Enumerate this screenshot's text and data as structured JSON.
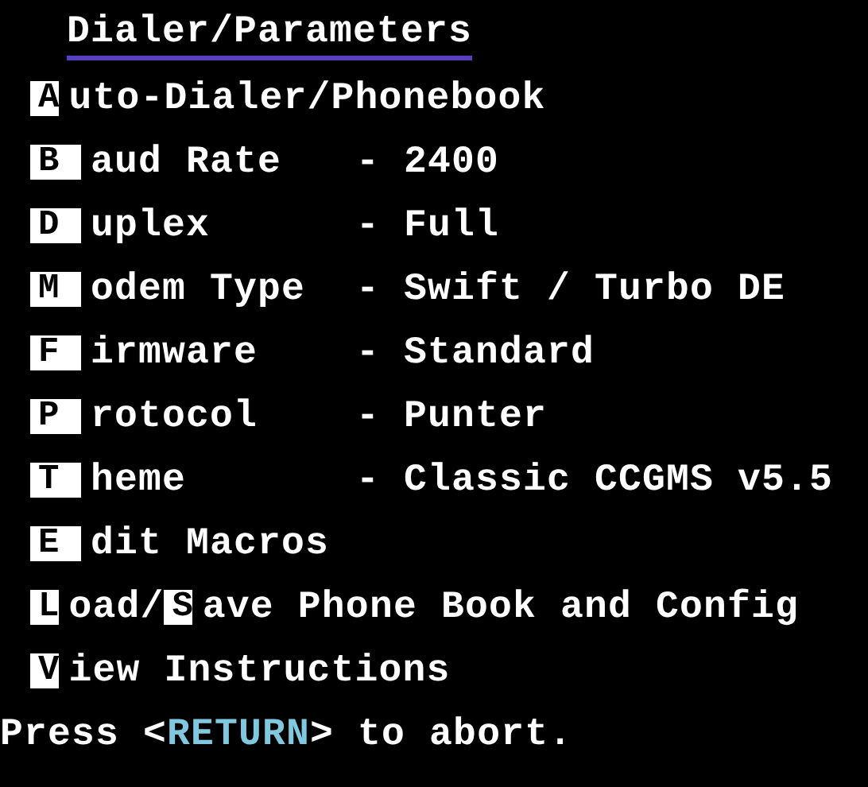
{
  "title": "Dialer/Parameters",
  "items": [
    {
      "parts": [
        {
          "kind": "key",
          "text": "A"
        },
        {
          "kind": "text",
          "text": "uto-Dialer/Phonebook"
        }
      ]
    },
    {
      "parts": [
        {
          "kind": "key",
          "text": "B"
        },
        {
          "kind": "text",
          "text": "aud Rate"
        }
      ],
      "value": "- 2400"
    },
    {
      "parts": [
        {
          "kind": "key",
          "text": "D"
        },
        {
          "kind": "text",
          "text": "uplex"
        }
      ],
      "value": "- Full"
    },
    {
      "parts": [
        {
          "kind": "key",
          "text": "M"
        },
        {
          "kind": "text",
          "text": "odem Type"
        }
      ],
      "value": "- Swift / Turbo DE"
    },
    {
      "parts": [
        {
          "kind": "key",
          "text": "F"
        },
        {
          "kind": "text",
          "text": "irmware"
        }
      ],
      "value": "- Standard"
    },
    {
      "parts": [
        {
          "kind": "key",
          "text": "P"
        },
        {
          "kind": "text",
          "text": "rotocol"
        }
      ],
      "value": "- Punter"
    },
    {
      "parts": [
        {
          "kind": "key",
          "text": "T"
        },
        {
          "kind": "text",
          "text": "heme"
        }
      ],
      "value": "- Classic CCGMS v5.5"
    },
    {
      "parts": [
        {
          "kind": "key",
          "text": "E"
        },
        {
          "kind": "text",
          "text": "dit Macros"
        }
      ]
    },
    {
      "parts": [
        {
          "kind": "key",
          "text": "L"
        },
        {
          "kind": "text",
          "text": "oad/"
        },
        {
          "kind": "key",
          "text": "S"
        },
        {
          "kind": "text",
          "text": "ave Phone Book and Config"
        }
      ]
    },
    {
      "parts": [
        {
          "kind": "key",
          "text": "V"
        },
        {
          "kind": "text",
          "text": "iew Instructions"
        }
      ]
    }
  ],
  "footer": [
    {
      "kind": "text",
      "text": "Press <"
    },
    {
      "kind": "highlight",
      "text": "RETURN"
    },
    {
      "kind": "text",
      "text": "> to abort."
    }
  ]
}
